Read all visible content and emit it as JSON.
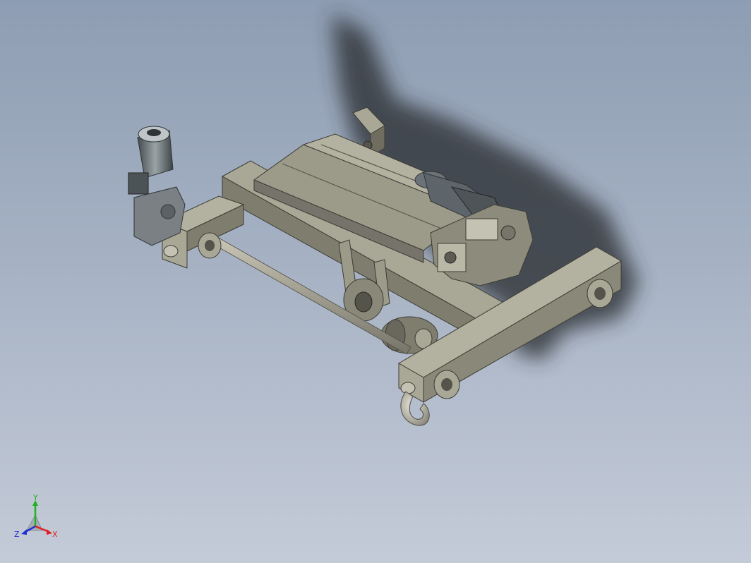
{
  "viewport": {
    "background_top": "#8e9db3",
    "background_bottom": "#c4cbd8"
  },
  "model": {
    "description_icon": "crane-trolley-hoist-icon",
    "body_color": "#8a8878",
    "body_shade": "#6f6d60",
    "body_light": "#a9a796",
    "motor_color": "#5f6a6e"
  },
  "triad": {
    "x_label": "X",
    "y_label": "Y",
    "z_label": "Z",
    "x_color": "#e02020",
    "y_color": "#20b020",
    "z_color": "#2030d0"
  }
}
